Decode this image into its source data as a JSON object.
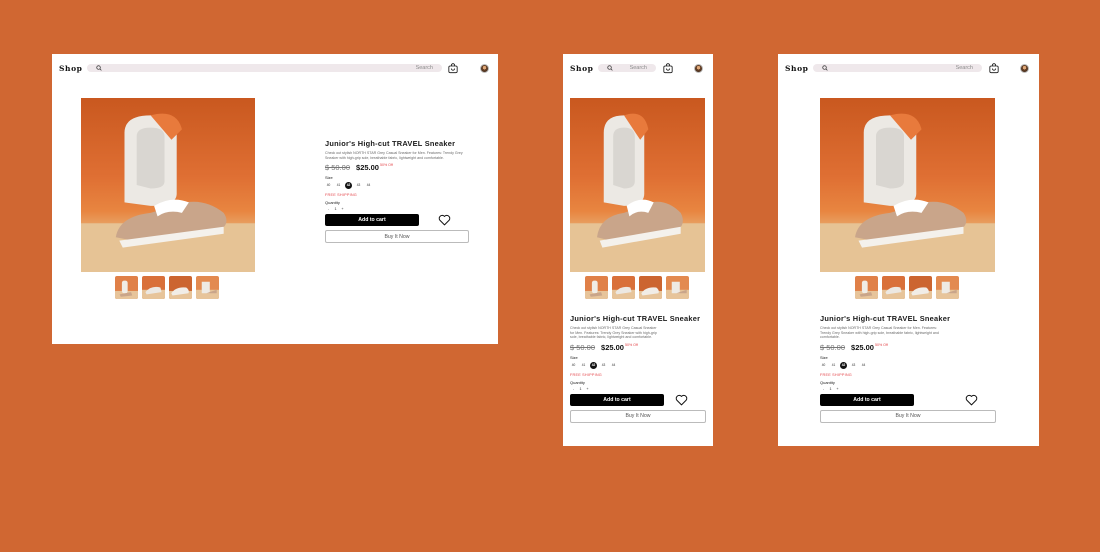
{
  "header": {
    "logo": "Shop",
    "search_placeholder": "Search",
    "icons": [
      "search-icon",
      "cart-icon",
      "avatar"
    ]
  },
  "product": {
    "title": "Junior's High-cut TRAVEL Sneaker",
    "description": "Check out stylish NORTH STAR Grey Casual Sneaker for Men. Features: Trendy Grey Sneaker with high-grip sole, breathable fabric, lightweight and comfortable.",
    "old_price": "$ 50.00",
    "price": "$25.00",
    "discount": "50% Off",
    "size_label": "Size",
    "sizes": [
      "40",
      "41",
      "42",
      "43",
      "44"
    ],
    "selected_size": "42",
    "free_shipping": "FREE SHIPPING",
    "quantity_label": "Quantity",
    "quantity_minus": "-",
    "quantity_value": "1",
    "quantity_plus": "+",
    "add_to_cart": "Add to cart",
    "buy_now": "Buy It Now"
  },
  "colors": {
    "background": "#d06732",
    "accent_red": "#e4464b",
    "button_black": "#000000"
  }
}
